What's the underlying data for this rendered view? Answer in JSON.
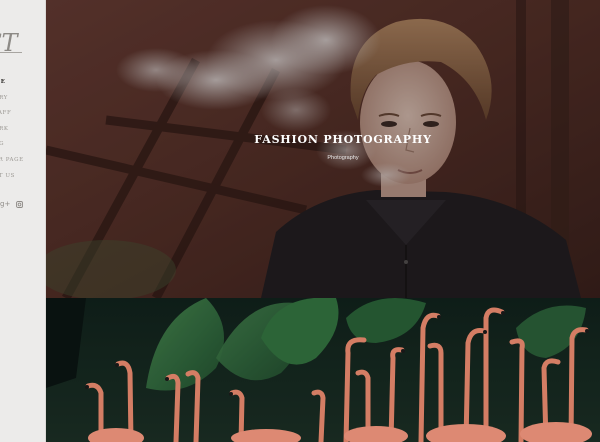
{
  "brand": {
    "logo_text": "ST"
  },
  "nav": {
    "items": [
      {
        "label": "ME",
        "active": true
      },
      {
        "label": "ORY",
        "active": false
      },
      {
        "label": "TAFF",
        "active": false
      },
      {
        "label": "ORK",
        "active": false
      },
      {
        "label": "OG",
        "active": false
      },
      {
        "label": "ER PAGE",
        "active": false
      },
      {
        "label": "CT US",
        "active": false
      }
    ]
  },
  "social": {
    "google_label": "g+",
    "instagram_icon": "instagram-icon"
  },
  "hero": {
    "title": "FASHION PHOTOGRAPHY",
    "category": "Photography"
  },
  "colors": {
    "sidebar_bg": "#ecebea",
    "nav_active": "#2d2b29",
    "nav_inactive": "#9a9792",
    "hero_title": "#ffffff"
  }
}
